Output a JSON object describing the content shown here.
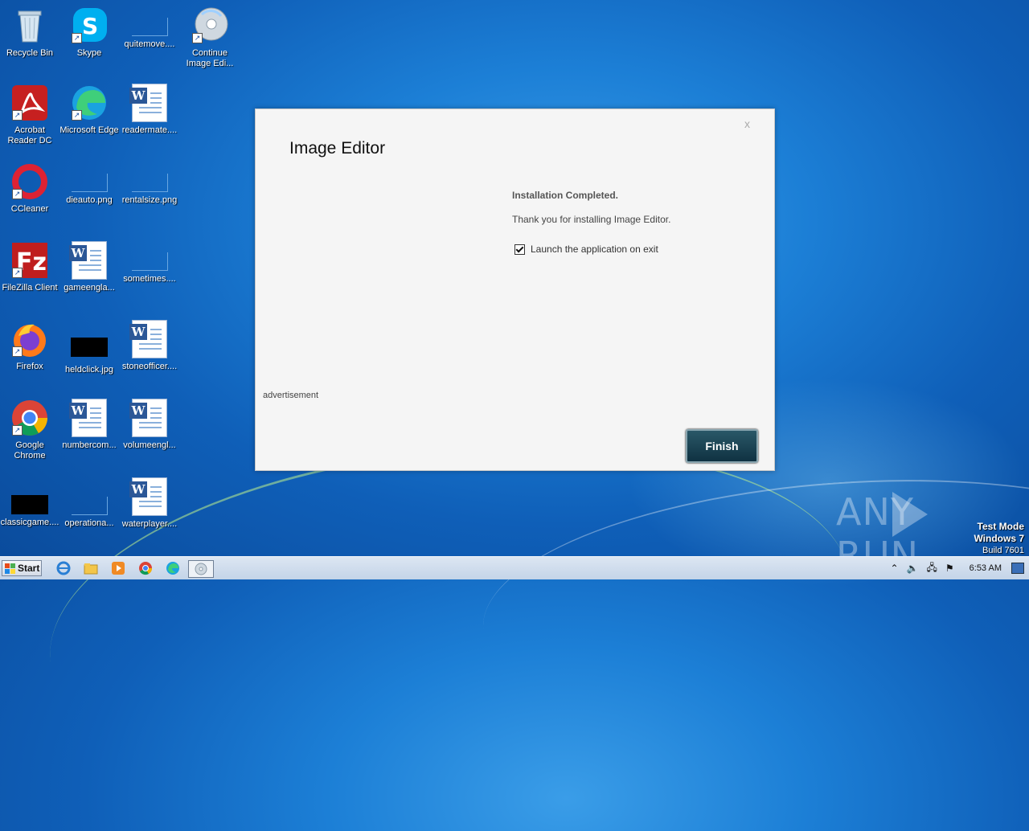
{
  "desktop": {
    "icons": [
      {
        "label": "Recycle Bin",
        "icon": "recycle-bin-icon"
      },
      {
        "label": "Skype",
        "icon": "skype-icon"
      },
      {
        "label": "quitemove....",
        "icon": "blank-file-icon"
      },
      {
        "label": "Continue Image Edi...",
        "icon": "cd-installer-icon"
      },
      {
        "label": "Acrobat Reader DC",
        "icon": "acrobat-icon"
      },
      {
        "label": "Microsoft Edge",
        "icon": "edge-icon"
      },
      {
        "label": "readermate....",
        "icon": "word-doc-icon"
      },
      {
        "label": "CCleaner",
        "icon": "ccleaner-icon"
      },
      {
        "label": "dieauto.png",
        "icon": "image-file-icon"
      },
      {
        "label": "rentalsize.png",
        "icon": "image-file-icon"
      },
      {
        "label": "FileZilla Client",
        "icon": "filezilla-icon"
      },
      {
        "label": "gameengla...",
        "icon": "word-doc-icon"
      },
      {
        "label": "sometimes....",
        "icon": "blank-file-icon"
      },
      {
        "label": "Firefox",
        "icon": "firefox-icon"
      },
      {
        "label": "heldclick.jpg",
        "icon": "image-file-icon"
      },
      {
        "label": "stoneofficer....",
        "icon": "word-doc-icon"
      },
      {
        "label": "Google Chrome",
        "icon": "chrome-icon"
      },
      {
        "label": "numbercom...",
        "icon": "word-doc-icon"
      },
      {
        "label": "volumeengl...",
        "icon": "word-doc-icon"
      },
      {
        "label": "classicgame....",
        "icon": "image-file-icon"
      },
      {
        "label": "operationa...",
        "icon": "blank-file-icon"
      },
      {
        "label": "waterplayer....",
        "icon": "word-doc-icon"
      }
    ]
  },
  "dialog": {
    "title": "Image Editor",
    "close_label": "x",
    "heading": "Installation Completed.",
    "message": "Thank you for installing Image Editor.",
    "checkbox_label": "Launch the application on exit",
    "checkbox_checked": true,
    "advertisement_label": "advertisement",
    "finish_label": "Finish",
    "finish_color": "#0f3242"
  },
  "watermark": {
    "left": "ANY",
    "right": "RUN"
  },
  "os_info": {
    "line1": "Test Mode",
    "line2": "Windows 7",
    "line3": "Build 7601"
  },
  "taskbar": {
    "start_label": "Start",
    "pinned": [
      "ie-icon",
      "explorer-icon",
      "media-player-icon",
      "chrome-icon",
      "edge-icon",
      "installer-icon"
    ],
    "tray_chevron": "⌃",
    "clock": "6:53 AM"
  }
}
